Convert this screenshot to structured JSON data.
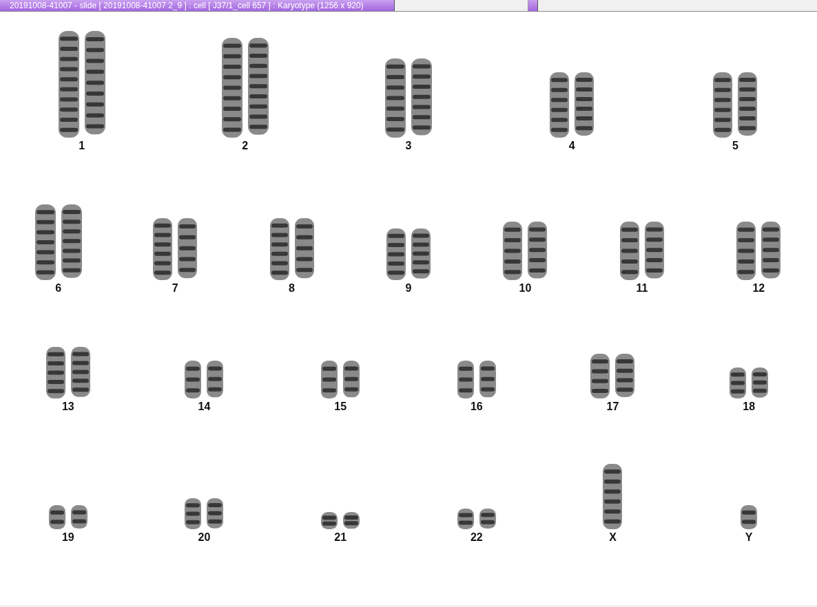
{
  "title_bar": {
    "tab_title": "20191008-41007 - slide [ 20191008-41007 2_9 ] : cell [ J37/1_cell 657 ] : Karyotype  (1256 x 920)"
  },
  "karyotype": {
    "rows": [
      {
        "groups": [
          {
            "label": "1",
            "kind": "pair"
          },
          {
            "label": "2",
            "kind": "pair"
          },
          {
            "label": "3",
            "kind": "pair"
          },
          {
            "label": "4",
            "kind": "pair"
          },
          {
            "label": "5",
            "kind": "pair"
          }
        ]
      },
      {
        "groups": [
          {
            "label": "6",
            "kind": "pair"
          },
          {
            "label": "7",
            "kind": "pair"
          },
          {
            "label": "8",
            "kind": "pair"
          },
          {
            "label": "9",
            "kind": "pair"
          },
          {
            "label": "10",
            "kind": "pair"
          },
          {
            "label": "11",
            "kind": "pair"
          },
          {
            "label": "12",
            "kind": "pair"
          }
        ]
      },
      {
        "groups": [
          {
            "label": "13",
            "kind": "pair"
          },
          {
            "label": "14",
            "kind": "pair"
          },
          {
            "label": "15",
            "kind": "pair"
          },
          {
            "label": "16",
            "kind": "pair"
          },
          {
            "label": "17",
            "kind": "pair"
          },
          {
            "label": "18",
            "kind": "pair"
          }
        ]
      },
      {
        "groups": [
          {
            "label": "19",
            "kind": "pair"
          },
          {
            "label": "20",
            "kind": "pair"
          },
          {
            "label": "21",
            "kind": "pair"
          },
          {
            "label": "22",
            "kind": "pair"
          },
          {
            "label": "X",
            "kind": "single"
          },
          {
            "label": "Y",
            "kind": "single"
          }
        ]
      }
    ]
  }
}
